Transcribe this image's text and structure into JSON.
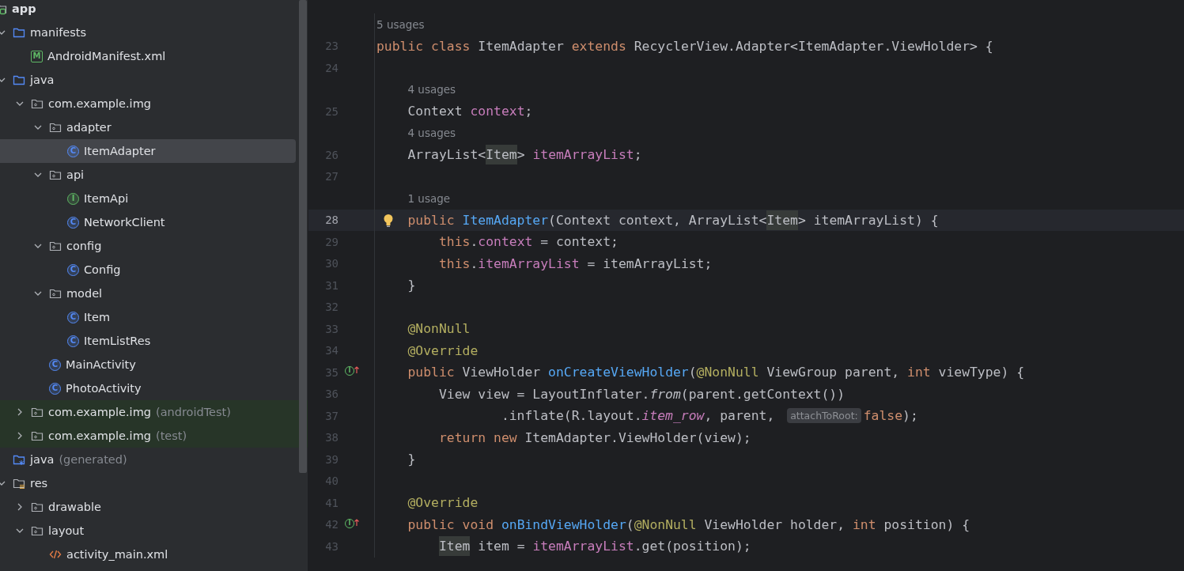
{
  "project_tree": [
    {
      "label": "app",
      "icon": {
        "kind": "module"
      },
      "selected": false,
      "children": [
        {
          "label": "manifests",
          "icon": {
            "kind": "folder"
          },
          "selected": false,
          "expanded": true,
          "children": [
            {
              "label": "AndroidManifest.xml",
              "icon": {
                "kind": "manifest",
                "letter": "M"
              },
              "selected": false
            }
          ]
        },
        {
          "label": "java",
          "icon": {
            "kind": "folder"
          },
          "selected": false,
          "expanded": true,
          "children": [
            {
              "label": "com.example.img",
              "icon": {
                "kind": "package"
              },
              "selected": false,
              "expanded": true,
              "children": [
                {
                  "label": "adapter",
                  "icon": {
                    "kind": "package"
                  },
                  "selected": false,
                  "expanded": true,
                  "children": [
                    {
                      "label": "ItemAdapter",
                      "icon": {
                        "kind": "class",
                        "letter": "C"
                      },
                      "selected": true
                    }
                  ]
                },
                {
                  "label": "api",
                  "icon": {
                    "kind": "package"
                  },
                  "selected": false,
                  "expanded": true,
                  "children": [
                    {
                      "label": "ItemApi",
                      "icon": {
                        "kind": "interface",
                        "letter": "I"
                      },
                      "selected": false
                    },
                    {
                      "label": "NetworkClient",
                      "icon": {
                        "kind": "class",
                        "letter": "C"
                      },
                      "selected": false
                    }
                  ]
                },
                {
                  "label": "config",
                  "icon": {
                    "kind": "package"
                  },
                  "selected": false,
                  "expanded": true,
                  "children": [
                    {
                      "label": "Config",
                      "icon": {
                        "kind": "class",
                        "letter": "C"
                      },
                      "selected": false
                    }
                  ]
                },
                {
                  "label": "model",
                  "icon": {
                    "kind": "package"
                  },
                  "selected": false,
                  "expanded": true,
                  "children": [
                    {
                      "label": "Item",
                      "icon": {
                        "kind": "class",
                        "letter": "C"
                      },
                      "selected": false
                    },
                    {
                      "label": "ItemListRes",
                      "icon": {
                        "kind": "class",
                        "letter": "C"
                      },
                      "selected": false
                    }
                  ]
                },
                {
                  "label": "MainActivity",
                  "icon": {
                    "kind": "class",
                    "letter": "C"
                  },
                  "selected": false
                },
                {
                  "label": "PhotoActivity",
                  "icon": {
                    "kind": "class",
                    "letter": "C"
                  },
                  "selected": false
                }
              ]
            },
            {
              "label": "com.example.img",
              "hint": "(androidTest)",
              "test_source": true,
              "icon": {
                "kind": "package"
              },
              "selected": false,
              "expanded": false
            },
            {
              "label": "com.example.img",
              "hint": "(test)",
              "test_source": true,
              "icon": {
                "kind": "package"
              },
              "selected": false,
              "expanded": false
            }
          ]
        },
        {
          "label": "java",
          "hint": "(generated)",
          "icon": {
            "kind": "generated"
          },
          "selected": false
        },
        {
          "label": "res",
          "icon": {
            "kind": "res"
          },
          "selected": false,
          "expanded": true,
          "children": [
            {
              "label": "drawable",
              "icon": {
                "kind": "package"
              },
              "selected": false,
              "expanded": false
            },
            {
              "label": "layout",
              "icon": {
                "kind": "package"
              },
              "selected": false,
              "expanded": true,
              "children": [
                {
                  "label": "activity_main.xml",
                  "icon": {
                    "kind": "layout"
                  },
                  "selected": false
                }
              ]
            }
          ]
        }
      ]
    }
  ],
  "editor": {
    "lines": [
      {
        "number": "23",
        "kind": "top",
        "usages": "5 usages",
        "tokens": [
          {
            "kind": "kw",
            "text": "public class "
          },
          {
            "kind": "plain",
            "text": "ItemAdapter "
          },
          {
            "kind": "kw",
            "text": "extends "
          },
          {
            "kind": "plain",
            "text": "RecyclerView.Adapter<ItemAdapter.ViewHolder> {"
          }
        ]
      },
      {
        "number": "24",
        "kind": "blank"
      },
      {
        "number": "25",
        "usages": "4 usages",
        "kind": "member",
        "tokens": [
          {
            "kind": "plain",
            "text": "Context "
          },
          {
            "kind": "field",
            "text": "context"
          },
          {
            "kind": "plain",
            "text": ";"
          }
        ]
      },
      {
        "number": "26",
        "usages": "4 usages",
        "kind": "member",
        "tokens": [
          {
            "kind": "plain",
            "text": "ArrayList<"
          },
          {
            "kind": "ref",
            "text": "Item"
          },
          {
            "kind": "plain",
            "text": "> "
          },
          {
            "kind": "field",
            "text": "itemArrayList"
          },
          {
            "kind": "plain",
            "text": ";"
          }
        ]
      },
      {
        "number": "27",
        "kind": "blank"
      },
      {
        "number": "28",
        "usages": "1 usage",
        "current": true,
        "marker": {
          "kind": "bulb"
        },
        "kind": "member",
        "tokens": [
          {
            "kind": "kw",
            "text": "public "
          },
          {
            "kind": "fn",
            "text": "ItemAdapter"
          },
          {
            "kind": "plain",
            "text": "(Context context, ArrayList<"
          },
          {
            "kind": "ref",
            "text": "Item"
          },
          {
            "kind": "plain",
            "text": "> itemArrayList) {"
          }
        ]
      },
      {
        "number": "29",
        "kind": "body",
        "tokens": [
          {
            "kind": "kw",
            "text": "this"
          },
          {
            "kind": "plain",
            "text": "."
          },
          {
            "kind": "field",
            "text": "context"
          },
          {
            "kind": "plain",
            "text": " = context;"
          }
        ]
      },
      {
        "number": "30",
        "kind": "body",
        "tokens": [
          {
            "kind": "kw",
            "text": "this"
          },
          {
            "kind": "plain",
            "text": "."
          },
          {
            "kind": "field",
            "text": "itemArrayList"
          },
          {
            "kind": "plain",
            "text": " = itemArrayList;"
          }
        ]
      },
      {
        "number": "31",
        "kind": "member",
        "tokens": [
          {
            "kind": "plain",
            "text": "}"
          }
        ]
      },
      {
        "number": "32",
        "kind": "blank"
      },
      {
        "number": "33",
        "kind": "member",
        "tokens": [
          {
            "kind": "ann",
            "text": "@NonNull"
          }
        ]
      },
      {
        "number": "34",
        "kind": "member",
        "tokens": [
          {
            "kind": "ann",
            "text": "@Override"
          }
        ]
      },
      {
        "number": "35",
        "marker": {
          "kind": "implements",
          "letter": "I"
        },
        "kind": "member",
        "tokens": [
          {
            "kind": "kw",
            "text": "public "
          },
          {
            "kind": "plain",
            "text": "ViewHolder "
          },
          {
            "kind": "fn",
            "text": "onCreateViewHolder"
          },
          {
            "kind": "plain",
            "text": "("
          },
          {
            "kind": "ann",
            "text": "@NonNull "
          },
          {
            "kind": "plain",
            "text": "ViewGroup parent, "
          },
          {
            "kind": "kw",
            "text": "int "
          },
          {
            "kind": "plain",
            "text": "viewType) {"
          }
        ]
      },
      {
        "number": "36",
        "kind": "body",
        "tokens": [
          {
            "kind": "plain",
            "text": "View view = LayoutInflater."
          },
          {
            "kind": "static",
            "text": "from"
          },
          {
            "kind": "plain",
            "text": "(parent.getContext())"
          }
        ]
      },
      {
        "number": "37",
        "kind": "continuation",
        "tokens": [
          {
            "kind": "plain",
            "text": ".inflate(R.layout."
          },
          {
            "kind": "static_field",
            "text": "item_row"
          },
          {
            "kind": "plain",
            "text": ", parent, "
          },
          {
            "kind": "hint",
            "text": "attachToRoot:"
          },
          {
            "kind": "kw",
            "text": "false"
          },
          {
            "kind": "plain",
            "text": ");"
          }
        ]
      },
      {
        "number": "38",
        "kind": "body",
        "tokens": [
          {
            "kind": "kw",
            "text": "return new "
          },
          {
            "kind": "plain",
            "text": "ItemAdapter.ViewHolder(view);"
          }
        ]
      },
      {
        "number": "39",
        "kind": "member",
        "tokens": [
          {
            "kind": "plain",
            "text": "}"
          }
        ]
      },
      {
        "number": "40",
        "kind": "blank"
      },
      {
        "number": "41",
        "kind": "member",
        "tokens": [
          {
            "kind": "ann",
            "text": "@Override"
          }
        ]
      },
      {
        "number": "42",
        "marker": {
          "kind": "implements",
          "letter": "I"
        },
        "kind": "member",
        "tokens": [
          {
            "kind": "kw",
            "text": "public void "
          },
          {
            "kind": "fn",
            "text": "onBindViewHolder"
          },
          {
            "kind": "plain",
            "text": "("
          },
          {
            "kind": "ann",
            "text": "@NonNull "
          },
          {
            "kind": "plain",
            "text": "ViewHolder holder, "
          },
          {
            "kind": "kw",
            "text": "int "
          },
          {
            "kind": "plain",
            "text": "position) {"
          }
        ]
      },
      {
        "number": "43",
        "kind": "body",
        "tokens": [
          {
            "kind": "ref",
            "text": "Item"
          },
          {
            "kind": "plain",
            "text": " item = "
          },
          {
            "kind": "field",
            "text": "itemArrayList"
          },
          {
            "kind": "plain",
            "text": ".get(position);"
          }
        ]
      }
    ]
  }
}
